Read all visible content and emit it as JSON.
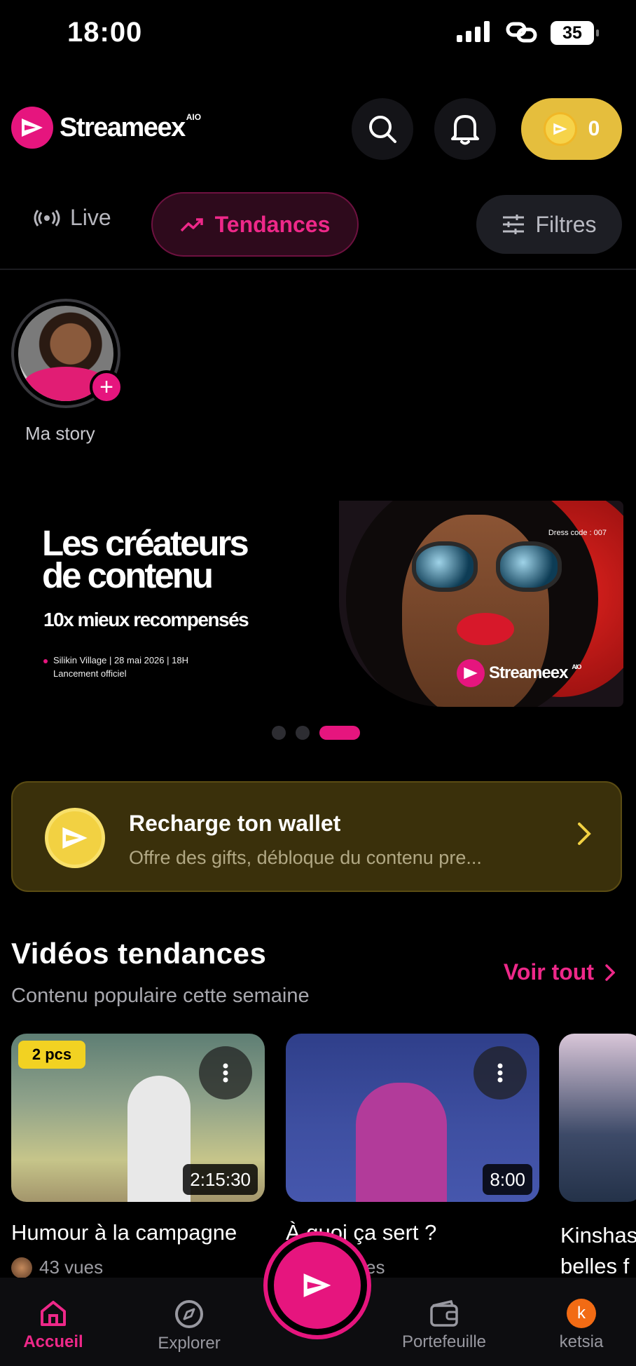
{
  "status_bar": {
    "time": "18:00",
    "battery": "35"
  },
  "header": {
    "brand": "Streameex",
    "brand_suffix": "AIO",
    "coins": "0",
    "brand_color": "#e6157e",
    "coin_color": "#e5be3d"
  },
  "tabs": {
    "live": "Live",
    "trending": "Tendances",
    "filters": "Filtres"
  },
  "story": {
    "label": "Ma story"
  },
  "banner": {
    "title_line1": "Les créateurs",
    "title_line2": "de contenu",
    "subtitle": "10x mieux recompensés",
    "info_line1": "Silikin Village | 28 mai 2026 | 18H",
    "info_line2": "Lancement officiel",
    "dress_code": "Dress code : 007",
    "logo": "Streameex",
    "logo_suffix": "AIO",
    "carousel_active_index": 2,
    "carousel_count": 3
  },
  "wallet": {
    "title": "Recharge ton wallet",
    "subtitle": "Offre des gifts, débloque du contenu pre..."
  },
  "trending": {
    "title": "Vidéos tendances",
    "subtitle": "Contenu populaire cette semaine",
    "see_all": "Voir tout",
    "videos": [
      {
        "title": "Humour à la campagne",
        "views": "43 vues",
        "duration": "2:15:30",
        "badge": "2 pcs"
      },
      {
        "title": "À quoi ça sert ?",
        "views": "es",
        "duration": "8:00"
      },
      {
        "title_line1": "Kinshas",
        "title_line2": "belles f"
      }
    ]
  },
  "bottom_nav": {
    "home": "Accueil",
    "explore": "Explorer",
    "wallet": "Portefeuille",
    "profile": "ketsia",
    "profile_initial": "k"
  }
}
